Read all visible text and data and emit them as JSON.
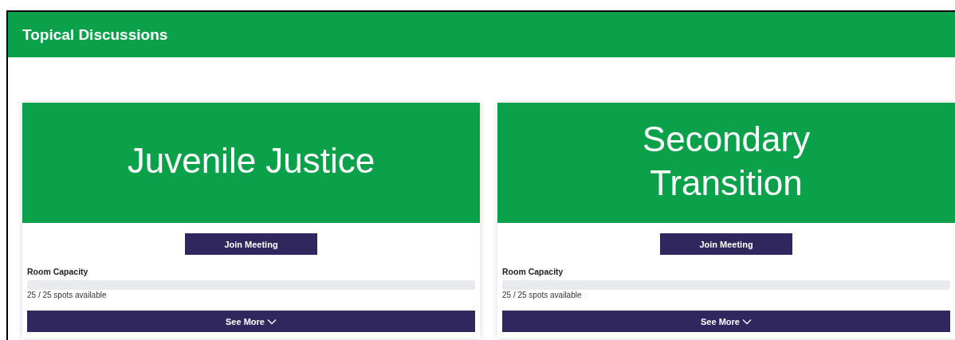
{
  "header": {
    "title": "Topical Discussions"
  },
  "cards": [
    {
      "banner_title": "Juvenile Justice",
      "join_button": "Join Meeting",
      "capacity_label": "Room Capacity",
      "capacity": {
        "level": 0
      },
      "spots": "25 / 25 spots available",
      "see_more": "See More"
    },
    {
      "banner_title": "Secondary Transition",
      "join_button": "Join Meeting",
      "capacity_label": "Room Capacity",
      "capacity": {
        "level": 0
      },
      "spots": "25 / 25 spots available",
      "see_more": "See More"
    }
  ]
}
